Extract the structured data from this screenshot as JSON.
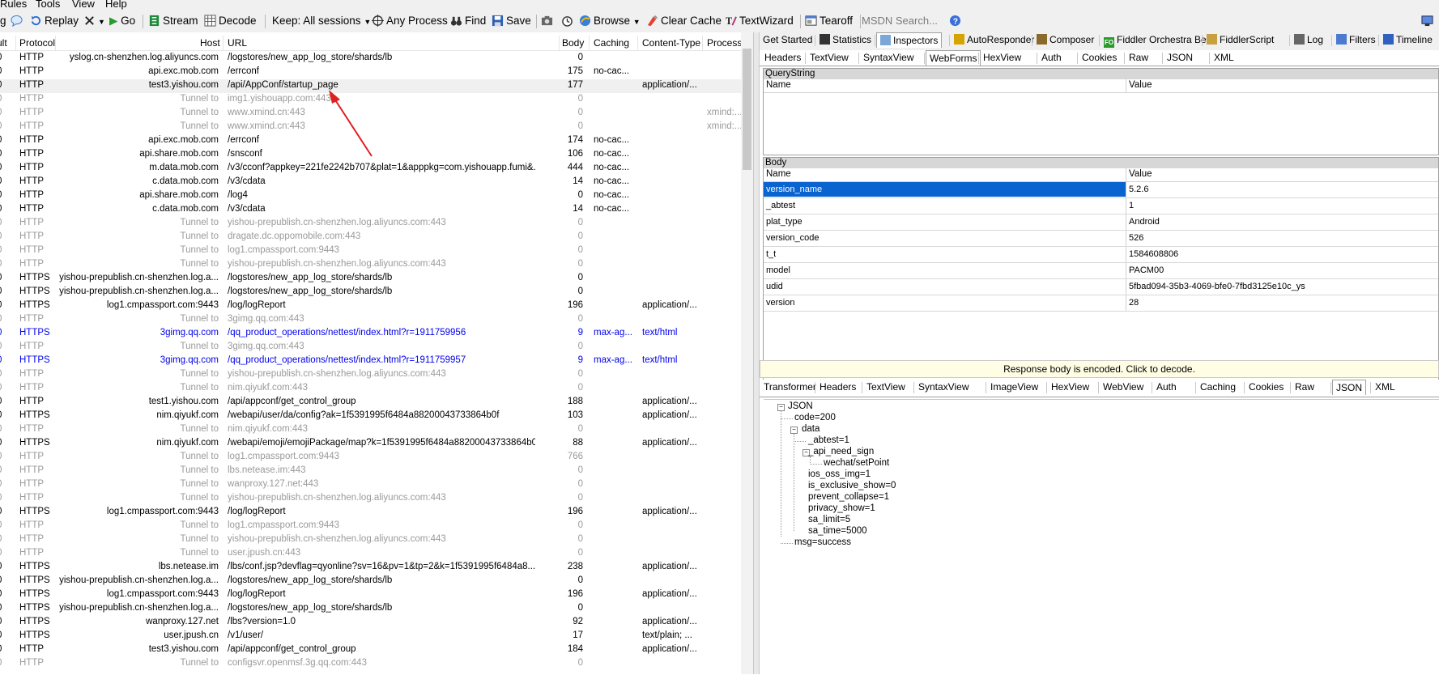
{
  "menu": {
    "items": [
      "Rules",
      "Tools",
      "View",
      "Help"
    ]
  },
  "toolbar": {
    "replay": "Replay",
    "go": "Go",
    "stream": "Stream",
    "decode": "Decode",
    "keep": "Keep: All sessions",
    "process": "Any Process",
    "find": "Find",
    "save": "Save",
    "browse": "Browse",
    "clear_cache": "Clear Cache",
    "textwizard": "TextWizard",
    "tearoff": "Tearoff",
    "msdn_placeholder": "MSDN Search..."
  },
  "sessions": {
    "columns": [
      "ult",
      "Protocol",
      "Host",
      "URL",
      "Body",
      "Caching",
      "Content-Type",
      "Process"
    ],
    "rows": [
      {
        "r": "0",
        "protocol": "HTTP",
        "host": "yslog.cn-shenzhen.log.aliyuncs.com",
        "url": "/logstores/new_app_log_store/shards/lb",
        "body": "0",
        "caching": "",
        "ctype": "",
        "process": "",
        "style": "normal"
      },
      {
        "r": "0",
        "protocol": "HTTP",
        "host": "api.exc.mob.com",
        "url": "/errconf",
        "body": "175",
        "caching": "no-cac...",
        "ctype": "",
        "process": "",
        "style": "normal"
      },
      {
        "r": "0",
        "protocol": "HTTP",
        "host": "test3.yishou.com",
        "url": "/api/AppConf/startup_page",
        "body": "177",
        "caching": "",
        "ctype": "application/...",
        "process": "",
        "style": "selected"
      },
      {
        "r": "0",
        "protocol": "HTTP",
        "host": "Tunnel to",
        "url": "img1.yishouapp.com:443",
        "body": "0",
        "caching": "",
        "ctype": "",
        "process": "",
        "style": "tunnel"
      },
      {
        "r": "0",
        "protocol": "HTTP",
        "host": "Tunnel to",
        "url": "www.xmind.cn:443",
        "body": "0",
        "caching": "",
        "ctype": "",
        "process": "xmind:...",
        "style": "tunnel"
      },
      {
        "r": "0",
        "protocol": "HTTP",
        "host": "Tunnel to",
        "url": "www.xmind.cn:443",
        "body": "0",
        "caching": "",
        "ctype": "",
        "process": "xmind:...",
        "style": "tunnel"
      },
      {
        "r": "0",
        "protocol": "HTTP",
        "host": "api.exc.mob.com",
        "url": "/errconf",
        "body": "174",
        "caching": "no-cac...",
        "ctype": "",
        "process": "",
        "style": "normal"
      },
      {
        "r": "0",
        "protocol": "HTTP",
        "host": "api.share.mob.com",
        "url": "/snsconf",
        "body": "106",
        "caching": "no-cac...",
        "ctype": "",
        "process": "",
        "style": "normal"
      },
      {
        "r": "0",
        "protocol": "HTTP",
        "host": "m.data.mob.com",
        "url": "/v3/cconf?appkey=221fe2242b707&plat=1&apppkg=com.yishouapp.fumi&...",
        "body": "444",
        "caching": "no-cac...",
        "ctype": "",
        "process": "",
        "style": "normal"
      },
      {
        "r": "0",
        "protocol": "HTTP",
        "host": "c.data.mob.com",
        "url": "/v3/cdata",
        "body": "14",
        "caching": "no-cac...",
        "ctype": "",
        "process": "",
        "style": "normal"
      },
      {
        "r": "0",
        "protocol": "HTTP",
        "host": "api.share.mob.com",
        "url": "/log4",
        "body": "0",
        "caching": "no-cac...",
        "ctype": "",
        "process": "",
        "style": "normal"
      },
      {
        "r": "0",
        "protocol": "HTTP",
        "host": "c.data.mob.com",
        "url": "/v3/cdata",
        "body": "14",
        "caching": "no-cac...",
        "ctype": "",
        "process": "",
        "style": "normal"
      },
      {
        "r": "0",
        "protocol": "HTTP",
        "host": "Tunnel to",
        "url": "yishou-prepublish.cn-shenzhen.log.aliyuncs.com:443",
        "body": "0",
        "caching": "",
        "ctype": "",
        "process": "",
        "style": "tunnel"
      },
      {
        "r": "0",
        "protocol": "HTTP",
        "host": "Tunnel to",
        "url": "dragate.dc.oppomobile.com:443",
        "body": "0",
        "caching": "",
        "ctype": "",
        "process": "",
        "style": "tunnel"
      },
      {
        "r": "0",
        "protocol": "HTTP",
        "host": "Tunnel to",
        "url": "log1.cmpassport.com:9443",
        "body": "0",
        "caching": "",
        "ctype": "",
        "process": "",
        "style": "tunnel"
      },
      {
        "r": "0",
        "protocol": "HTTP",
        "host": "Tunnel to",
        "url": "yishou-prepublish.cn-shenzhen.log.aliyuncs.com:443",
        "body": "0",
        "caching": "",
        "ctype": "",
        "process": "",
        "style": "tunnel"
      },
      {
        "r": "0",
        "protocol": "HTTPS",
        "host": "yishou-prepublish.cn-shenzhen.log.a...",
        "url": "/logstores/new_app_log_store/shards/lb",
        "body": "0",
        "caching": "",
        "ctype": "",
        "process": "",
        "style": "normal"
      },
      {
        "r": "0",
        "protocol": "HTTPS",
        "host": "yishou-prepublish.cn-shenzhen.log.a...",
        "url": "/logstores/new_app_log_store/shards/lb",
        "body": "0",
        "caching": "",
        "ctype": "",
        "process": "",
        "style": "normal"
      },
      {
        "r": "0",
        "protocol": "HTTPS",
        "host": "log1.cmpassport.com:9443",
        "url": "/log/logReport",
        "body": "196",
        "caching": "",
        "ctype": "application/...",
        "process": "",
        "style": "normal"
      },
      {
        "r": "0",
        "protocol": "HTTP",
        "host": "Tunnel to",
        "url": "3gimg.qq.com:443",
        "body": "0",
        "caching": "",
        "ctype": "",
        "process": "",
        "style": "tunnel"
      },
      {
        "r": "0",
        "protocol": "HTTPS",
        "host": "3gimg.qq.com",
        "url": "/qq_product_operations/nettest/index.html?r=1911759956",
        "body": "9",
        "caching": "max-ag...",
        "ctype": "text/html",
        "process": "",
        "style": "blue"
      },
      {
        "r": "0",
        "protocol": "HTTP",
        "host": "Tunnel to",
        "url": "3gimg.qq.com:443",
        "body": "0",
        "caching": "",
        "ctype": "",
        "process": "",
        "style": "tunnel"
      },
      {
        "r": "0",
        "protocol": "HTTPS",
        "host": "3gimg.qq.com",
        "url": "/qq_product_operations/nettest/index.html?r=1911759957",
        "body": "9",
        "caching": "max-ag...",
        "ctype": "text/html",
        "process": "",
        "style": "blue"
      },
      {
        "r": "0",
        "protocol": "HTTP",
        "host": "Tunnel to",
        "url": "yishou-prepublish.cn-shenzhen.log.aliyuncs.com:443",
        "body": "0",
        "caching": "",
        "ctype": "",
        "process": "",
        "style": "tunnel"
      },
      {
        "r": "0",
        "protocol": "HTTP",
        "host": "Tunnel to",
        "url": "nim.qiyukf.com:443",
        "body": "0",
        "caching": "",
        "ctype": "",
        "process": "",
        "style": "tunnel"
      },
      {
        "r": "0",
        "protocol": "HTTP",
        "host": "test1.yishou.com",
        "url": "/api/appconf/get_control_group",
        "body": "188",
        "caching": "",
        "ctype": "application/...",
        "process": "",
        "style": "normal"
      },
      {
        "r": "0",
        "protocol": "HTTPS",
        "host": "nim.qiyukf.com",
        "url": "/webapi/user/da/config?ak=1f5391995f6484a88200043733864b0f",
        "body": "103",
        "caching": "",
        "ctype": "application/...",
        "process": "",
        "style": "normal"
      },
      {
        "r": "0",
        "protocol": "HTTP",
        "host": "Tunnel to",
        "url": "nim.qiyukf.com:443",
        "body": "0",
        "caching": "",
        "ctype": "",
        "process": "",
        "style": "tunnel"
      },
      {
        "r": "0",
        "protocol": "HTTPS",
        "host": "nim.qiyukf.com",
        "url": "/webapi/emoji/emojiPackage/map?k=1f5391995f6484a88200043733864b0f",
        "body": "88",
        "caching": "",
        "ctype": "application/...",
        "process": "",
        "style": "normal"
      },
      {
        "r": "0",
        "protocol": "HTTP",
        "host": "Tunnel to",
        "url": "log1.cmpassport.com:9443",
        "body": "766",
        "caching": "",
        "ctype": "",
        "process": "",
        "style": "tunnel"
      },
      {
        "r": "0",
        "protocol": "HTTP",
        "host": "Tunnel to",
        "url": "lbs.netease.im:443",
        "body": "0",
        "caching": "",
        "ctype": "",
        "process": "",
        "style": "tunnel"
      },
      {
        "r": "0",
        "protocol": "HTTP",
        "host": "Tunnel to",
        "url": "wanproxy.127.net:443",
        "body": "0",
        "caching": "",
        "ctype": "",
        "process": "",
        "style": "tunnel"
      },
      {
        "r": "0",
        "protocol": "HTTP",
        "host": "Tunnel to",
        "url": "yishou-prepublish.cn-shenzhen.log.aliyuncs.com:443",
        "body": "0",
        "caching": "",
        "ctype": "",
        "process": "",
        "style": "tunnel"
      },
      {
        "r": "0",
        "protocol": "HTTPS",
        "host": "log1.cmpassport.com:9443",
        "url": "/log/logReport",
        "body": "196",
        "caching": "",
        "ctype": "application/...",
        "process": "",
        "style": "normal"
      },
      {
        "r": "0",
        "protocol": "HTTP",
        "host": "Tunnel to",
        "url": "log1.cmpassport.com:9443",
        "body": "0",
        "caching": "",
        "ctype": "",
        "process": "",
        "style": "tunnel"
      },
      {
        "r": "0",
        "protocol": "HTTP",
        "host": "Tunnel to",
        "url": "yishou-prepublish.cn-shenzhen.log.aliyuncs.com:443",
        "body": "0",
        "caching": "",
        "ctype": "",
        "process": "",
        "style": "tunnel"
      },
      {
        "r": "0",
        "protocol": "HTTP",
        "host": "Tunnel to",
        "url": "user.jpush.cn:443",
        "body": "0",
        "caching": "",
        "ctype": "",
        "process": "",
        "style": "tunnel"
      },
      {
        "r": "0",
        "protocol": "HTTPS",
        "host": "lbs.netease.im",
        "url": "/lbs/conf.jsp?devflag=qyonline?sv=16&pv=1&tp=2&k=1f5391995f6484a8...",
        "body": "238",
        "caching": "",
        "ctype": "application/...",
        "process": "",
        "style": "normal"
      },
      {
        "r": "0",
        "protocol": "HTTPS",
        "host": "yishou-prepublish.cn-shenzhen.log.a...",
        "url": "/logstores/new_app_log_store/shards/lb",
        "body": "0",
        "caching": "",
        "ctype": "",
        "process": "",
        "style": "normal"
      },
      {
        "r": "0",
        "protocol": "HTTPS",
        "host": "log1.cmpassport.com:9443",
        "url": "/log/logReport",
        "body": "196",
        "caching": "",
        "ctype": "application/...",
        "process": "",
        "style": "normal"
      },
      {
        "r": "0",
        "protocol": "HTTPS",
        "host": "yishou-prepublish.cn-shenzhen.log.a...",
        "url": "/logstores/new_app_log_store/shards/lb",
        "body": "0",
        "caching": "",
        "ctype": "",
        "process": "",
        "style": "normal"
      },
      {
        "r": "0",
        "protocol": "HTTPS",
        "host": "wanproxy.127.net",
        "url": "/lbs?version=1.0",
        "body": "92",
        "caching": "",
        "ctype": "application/...",
        "process": "",
        "style": "normal"
      },
      {
        "r": "0",
        "protocol": "HTTPS",
        "host": "user.jpush.cn",
        "url": "/v1/user/",
        "body": "17",
        "caching": "",
        "ctype": "text/plain; ...",
        "process": "",
        "style": "normal"
      },
      {
        "r": "0",
        "protocol": "HTTP",
        "host": "test3.yishou.com",
        "url": "/api/appconf/get_control_group",
        "body": "184",
        "caching": "",
        "ctype": "application/...",
        "process": "",
        "style": "normal"
      },
      {
        "r": "0",
        "protocol": "HTTP",
        "host": "Tunnel to",
        "url": "configsvr.openmsf.3g.qq.com:443",
        "body": "0",
        "caching": "",
        "ctype": "",
        "process": "",
        "style": "tunnel"
      }
    ]
  },
  "right": {
    "top_tabs": [
      "Get Started",
      "Statistics",
      "Inspectors",
      "AutoResponder",
      "Composer",
      "Fiddler Orchestra Beta",
      "FiddlerScript",
      "Log",
      "Filters",
      "Timeline"
    ],
    "request_tabs": [
      "Headers",
      "TextView",
      "SyntaxView",
      "WebForms",
      "HexView",
      "Auth",
      "Cookies",
      "Raw",
      "JSON",
      "XML"
    ],
    "querystring": {
      "title": "QueryString",
      "col_name": "Name",
      "col_value": "Value"
    },
    "body": {
      "title": "Body",
      "col_name": "Name",
      "col_value": "Value",
      "rows": [
        {
          "name": "version_name",
          "value": "5.2.6"
        },
        {
          "name": "_abtest",
          "value": "1"
        },
        {
          "name": "plat_type",
          "value": "Android"
        },
        {
          "name": "version_code",
          "value": "526"
        },
        {
          "name": "t_t",
          "value": "1584608806"
        },
        {
          "name": "model",
          "value": "PACM00"
        },
        {
          "name": "udid",
          "value": "5fbad094-35b3-4069-bfe0-7fbd3125e10c_ys"
        },
        {
          "name": "version",
          "value": "28"
        }
      ]
    },
    "decode_notice": "Response body is encoded. Click to decode.",
    "response_tabs": [
      "Transformer",
      "Headers",
      "TextView",
      "SyntaxView",
      "ImageView",
      "HexView",
      "WebView",
      "Auth",
      "Caching",
      "Cookies",
      "Raw",
      "JSON",
      "XML"
    ],
    "json_tree": {
      "root": "JSON",
      "code": "code=200",
      "data": "data",
      "abtest": "_abtest=1",
      "api_need_sign": "_api_need_sign",
      "wechat": "wechat/setPoint",
      "ios_oss_img": "ios_oss_img=1",
      "is_exclusive_show": "is_exclusive_show=0",
      "prevent_collapse": "prevent_collapse=1",
      "privacy_show": "privacy_show=1",
      "sa_limit": "sa_limit=5",
      "sa_time": "sa_time=5000",
      "msg": "msg=success"
    }
  },
  "colors": {
    "selection": "#0a64d0",
    "arrow": "#e02020",
    "link_blue": "#0000ee"
  }
}
